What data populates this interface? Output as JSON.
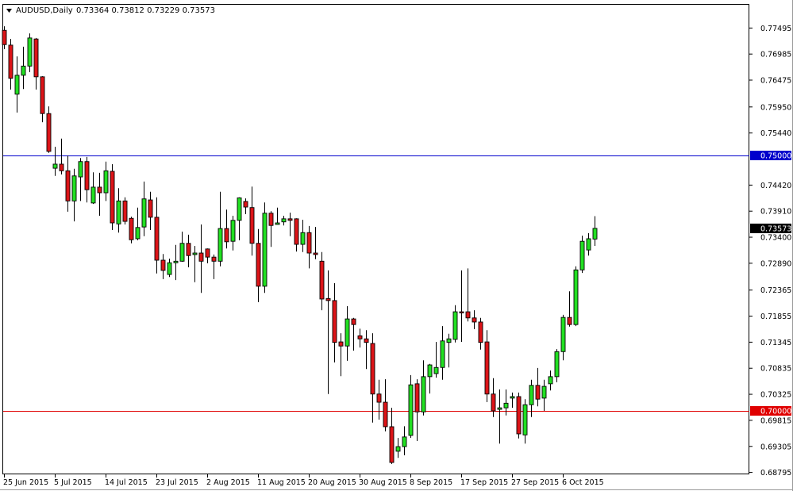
{
  "header": {
    "symbol_label": "AUDUSD,Daily",
    "ohlc_label": "0.73364 0.73812 0.73229 0.73573"
  },
  "colors": {
    "bull": "#22e022",
    "bear": "#dc1418",
    "outline": "#000000",
    "level_high": "#0000cc",
    "level_low": "#e00000",
    "current_bg": "#000000"
  },
  "chart_data": {
    "type": "candlestick",
    "title": "AUDUSD,Daily",
    "xlabel": "",
    "ylabel": "",
    "ylim": [
      0.68795,
      0.77495
    ],
    "grid": false,
    "y_ticks": [
      "0.77495",
      "0.76985",
      "0.76475",
      "0.75950",
      "0.75440",
      "0.74420",
      "0.73910",
      "0.73400",
      "0.72890",
      "0.72365",
      "0.71855",
      "0.71345",
      "0.70835",
      "0.70325",
      "0.69815",
      "0.69305",
      "0.68795"
    ],
    "x_tick_labels": [
      {
        "index": 0,
        "label": "25 Jun 2015"
      },
      {
        "index": 8,
        "label": "5 Jul 2015"
      },
      {
        "index": 16,
        "label": "14 Jul 2015"
      },
      {
        "index": 24,
        "label": "23 Jul 2015"
      },
      {
        "index": 32,
        "label": "2 Aug 2015"
      },
      {
        "index": 40,
        "label": "11 Aug 2015"
      },
      {
        "index": 48,
        "label": "20 Aug 2015"
      },
      {
        "index": 56,
        "label": "30 Aug 2015"
      },
      {
        "index": 64,
        "label": "8 Sep 2015"
      },
      {
        "index": 72,
        "label": "17 Sep 2015"
      },
      {
        "index": 80,
        "label": "27 Sep 2015"
      },
      {
        "index": 88,
        "label": "6 Oct 2015"
      }
    ],
    "horizontal_levels": [
      {
        "value": 0.75,
        "label": "0.75000",
        "color": "#0000cc"
      },
      {
        "value": 0.7,
        "label": "0.70000",
        "color": "#e00000"
      }
    ],
    "current_price": {
      "value": 0.73573,
      "label": "0.73573"
    },
    "ohlc": [
      [
        0.7745,
        0.7753,
        0.7708,
        0.7717
      ],
      [
        0.7716,
        0.7728,
        0.7629,
        0.7651
      ],
      [
        0.762,
        0.7694,
        0.7584,
        0.7657
      ],
      [
        0.7657,
        0.7713,
        0.763,
        0.7675
      ],
      [
        0.7675,
        0.7739,
        0.7663,
        0.773
      ],
      [
        0.7728,
        0.773,
        0.7629,
        0.7654
      ],
      [
        0.7654,
        0.7655,
        0.7565,
        0.7582
      ],
      [
        0.7582,
        0.7596,
        0.7505,
        0.7508
      ],
      [
        0.7475,
        0.7517,
        0.746,
        0.7483
      ],
      [
        0.7483,
        0.7533,
        0.7463,
        0.747
      ],
      [
        0.747,
        0.75,
        0.739,
        0.7411
      ],
      [
        0.7411,
        0.7474,
        0.7371,
        0.746
      ],
      [
        0.7458,
        0.7495,
        0.7411,
        0.7488
      ],
      [
        0.7488,
        0.7497,
        0.7408,
        0.7433
      ],
      [
        0.7407,
        0.7467,
        0.7405,
        0.7438
      ],
      [
        0.7438,
        0.7466,
        0.7382,
        0.7427
      ],
      [
        0.7427,
        0.7488,
        0.7411,
        0.747
      ],
      [
        0.7469,
        0.7483,
        0.7354,
        0.7368
      ],
      [
        0.7366,
        0.7436,
        0.7349,
        0.7411
      ],
      [
        0.7411,
        0.7418,
        0.7365,
        0.7371
      ],
      [
        0.7377,
        0.738,
        0.7328,
        0.7335
      ],
      [
        0.7337,
        0.7398,
        0.7334,
        0.7359
      ],
      [
        0.736,
        0.7449,
        0.7342,
        0.7415
      ],
      [
        0.7413,
        0.7429,
        0.7354,
        0.7379
      ],
      [
        0.7379,
        0.7418,
        0.7269,
        0.7295
      ],
      [
        0.7295,
        0.7307,
        0.7258,
        0.7275
      ],
      [
        0.7267,
        0.7298,
        0.7262,
        0.729
      ],
      [
        0.729,
        0.7325,
        0.7256,
        0.7293
      ],
      [
        0.7293,
        0.7351,
        0.7292,
        0.7328
      ],
      [
        0.7328,
        0.7345,
        0.7281,
        0.7304
      ],
      [
        0.7306,
        0.7323,
        0.7252,
        0.7309
      ],
      [
        0.7309,
        0.7365,
        0.7231,
        0.7293
      ],
      [
        0.7317,
        0.7318,
        0.7289,
        0.7301
      ],
      [
        0.7301,
        0.7306,
        0.7258,
        0.7293
      ],
      [
        0.7293,
        0.7429,
        0.7283,
        0.7357
      ],
      [
        0.7357,
        0.7394,
        0.7318,
        0.7331
      ],
      [
        0.7332,
        0.7382,
        0.7314,
        0.7373
      ],
      [
        0.7373,
        0.7418,
        0.7334,
        0.7417
      ],
      [
        0.741,
        0.7416,
        0.7385,
        0.7399
      ],
      [
        0.7398,
        0.7439,
        0.7304,
        0.7328
      ],
      [
        0.7328,
        0.7356,
        0.7213,
        0.7244
      ],
      [
        0.7244,
        0.7408,
        0.7231,
        0.7387
      ],
      [
        0.7387,
        0.7391,
        0.7321,
        0.7363
      ],
      [
        0.7365,
        0.7398,
        0.7365,
        0.7368
      ],
      [
        0.737,
        0.7382,
        0.7363,
        0.7376
      ],
      [
        0.7376,
        0.7388,
        0.7342,
        0.7373
      ],
      [
        0.7376,
        0.7377,
        0.7312,
        0.7326
      ],
      [
        0.7326,
        0.7374,
        0.7311,
        0.7349
      ],
      [
        0.7349,
        0.7362,
        0.7279,
        0.7309
      ],
      [
        0.7309,
        0.736,
        0.7297,
        0.7306
      ],
      [
        0.7293,
        0.7311,
        0.7197,
        0.7219
      ],
      [
        0.722,
        0.7275,
        0.7033,
        0.7216
      ],
      [
        0.7216,
        0.725,
        0.7095,
        0.7134
      ],
      [
        0.7135,
        0.7152,
        0.7068,
        0.7127
      ],
      [
        0.7127,
        0.7205,
        0.7098,
        0.718
      ],
      [
        0.718,
        0.7182,
        0.7118,
        0.7169
      ],
      [
        0.7147,
        0.7161,
        0.7124,
        0.7141
      ],
      [
        0.7141,
        0.7158,
        0.7082,
        0.7134
      ],
      [
        0.7132,
        0.7152,
        0.6977,
        0.7033
      ],
      [
        0.7033,
        0.7061,
        0.6983,
        0.7017
      ],
      [
        0.7017,
        0.7062,
        0.696,
        0.6969
      ],
      [
        0.6969,
        0.7006,
        0.6896,
        0.6899
      ],
      [
        0.6921,
        0.6947,
        0.6908,
        0.693
      ],
      [
        0.693,
        0.697,
        0.6913,
        0.6949
      ],
      [
        0.6952,
        0.707,
        0.6947,
        0.7051
      ],
      [
        0.7053,
        0.7062,
        0.6941,
        0.6998
      ],
      [
        0.6998,
        0.7099,
        0.6991,
        0.7067
      ],
      [
        0.7067,
        0.7092,
        0.7034,
        0.709
      ],
      [
        0.7073,
        0.7135,
        0.7065,
        0.7085
      ],
      [
        0.7085,
        0.7166,
        0.7061,
        0.7137
      ],
      [
        0.7134,
        0.7151,
        0.7085,
        0.7141
      ],
      [
        0.714,
        0.7207,
        0.7134,
        0.7194
      ],
      [
        0.7194,
        0.7275,
        0.7135,
        0.7193
      ],
      [
        0.7194,
        0.7279,
        0.7175,
        0.7182
      ],
      [
        0.7182,
        0.7197,
        0.716,
        0.7174
      ],
      [
        0.7174,
        0.7182,
        0.712,
        0.7134
      ],
      [
        0.7135,
        0.7158,
        0.7017,
        0.7033
      ],
      [
        0.7033,
        0.7064,
        0.6988,
        0.7
      ],
      [
        0.7003,
        0.7042,
        0.6936,
        0.7006
      ],
      [
        0.7006,
        0.7042,
        0.6991,
        0.7015
      ],
      [
        0.7025,
        0.7036,
        0.7006,
        0.7028
      ],
      [
        0.7028,
        0.7036,
        0.6946,
        0.6955
      ],
      [
        0.6953,
        0.7023,
        0.6936,
        0.7012
      ],
      [
        0.7012,
        0.7061,
        0.6988,
        0.705
      ],
      [
        0.705,
        0.7084,
        0.7009,
        0.7023
      ],
      [
        0.7025,
        0.7061,
        0.7,
        0.7048
      ],
      [
        0.7053,
        0.7079,
        0.704,
        0.7067
      ],
      [
        0.7067,
        0.7121,
        0.7056,
        0.7116
      ],
      [
        0.7116,
        0.7188,
        0.7099,
        0.7183
      ],
      [
        0.7183,
        0.7234,
        0.7165,
        0.7169
      ],
      [
        0.7169,
        0.7283,
        0.7166,
        0.7276
      ],
      [
        0.7276,
        0.7343,
        0.727,
        0.7332
      ],
      [
        0.7315,
        0.7348,
        0.7304,
        0.7337
      ],
      [
        0.73364,
        0.73812,
        0.73229,
        0.73573
      ]
    ]
  }
}
